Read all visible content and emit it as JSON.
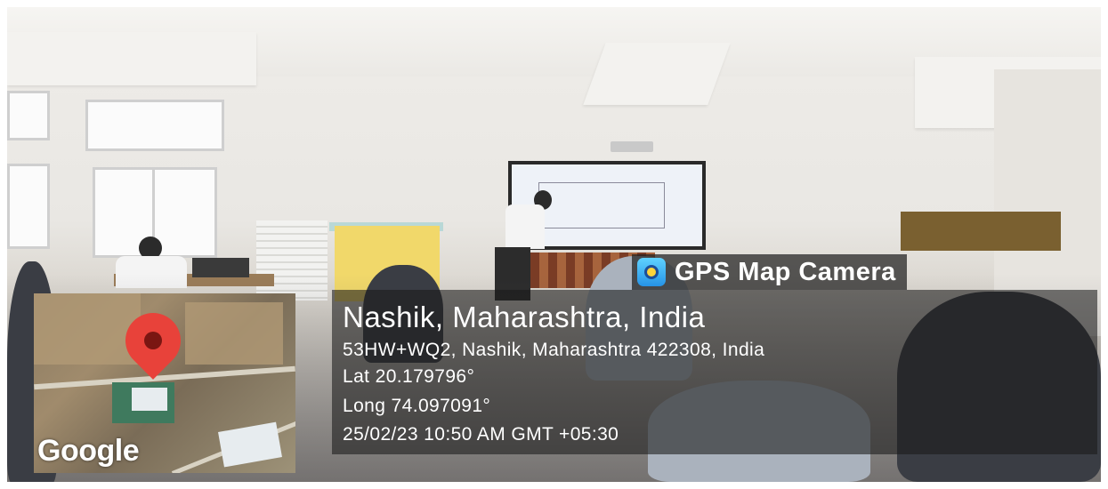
{
  "overlay": {
    "app_name": "GPS Map Camera",
    "app_icon": "gps-map-camera-app-icon",
    "place": "Nashik, Maharashtra, India",
    "address": "53HW+WQ2, Nashik, Maharashtra 422308, India",
    "latitude": "Lat 20.179796°",
    "longitude": "Long 74.097091°",
    "datetime": "25/02/23 10:50 AM GMT +05:30"
  },
  "map": {
    "attribution": "Google",
    "pin_icon": "location-pin-icon",
    "pin_color": "#e8423a"
  }
}
